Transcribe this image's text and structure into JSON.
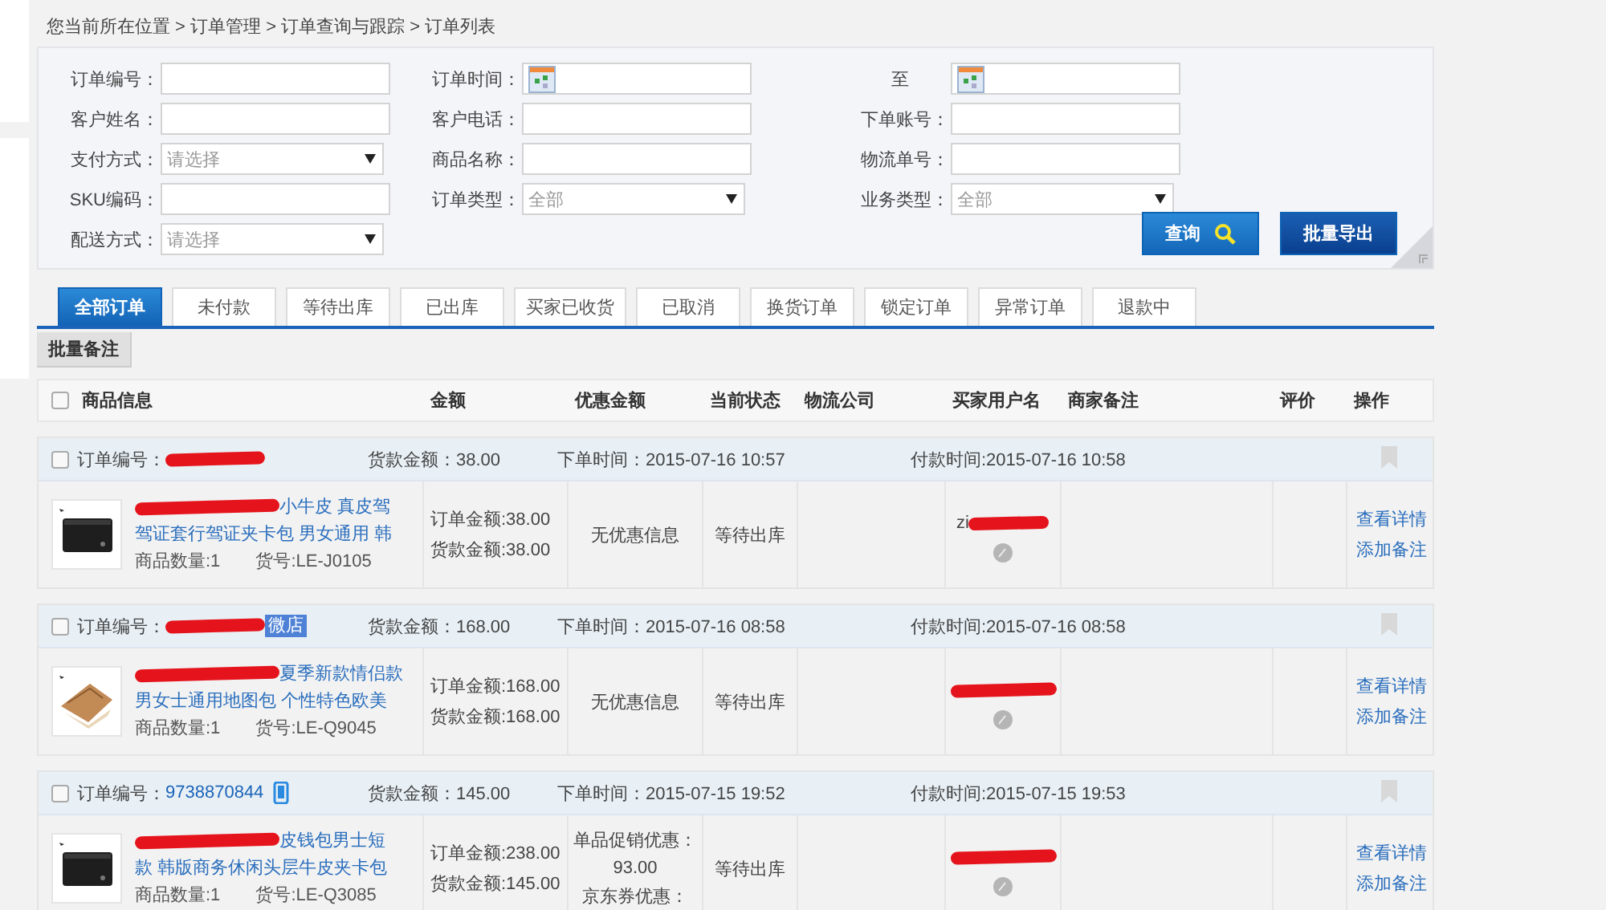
{
  "breadcrumb": "您当前所在位置 > 订单管理 > 订单查询与跟踪 > 订单列表",
  "filters": [
    {
      "label": "订单编号：",
      "kind": "text"
    },
    {
      "label": "订单时间：",
      "kind": "date"
    },
    {
      "label": "至",
      "kind": "date"
    },
    {
      "label": "客户姓名：",
      "kind": "text"
    },
    {
      "label": "客户电话：",
      "kind": "text"
    },
    {
      "label": "下单账号：",
      "kind": "text"
    },
    {
      "label": "支付方式：",
      "kind": "select",
      "value": "请选择"
    },
    {
      "label": "商品名称：",
      "kind": "text"
    },
    {
      "label": "物流单号：",
      "kind": "text"
    },
    {
      "label": "SKU编码：",
      "kind": "text"
    },
    {
      "label": "订单类型：",
      "kind": "select",
      "value": "全部"
    },
    {
      "label": "业务类型：",
      "kind": "select",
      "value": "全部"
    },
    {
      "label": "配送方式：",
      "kind": "select",
      "value": "请选择"
    }
  ],
  "buttons": [
    {
      "label": "查询",
      "kind": "search"
    },
    {
      "label": "批量导出",
      "kind": "export"
    }
  ],
  "tabs": [
    {
      "label": "全部订单",
      "selected": true
    },
    {
      "label": "未付款",
      "selected": false
    },
    {
      "label": "等待出库",
      "selected": false
    },
    {
      "label": "已出库",
      "selected": false
    },
    {
      "label": "买家已收货",
      "selected": false
    },
    {
      "label": "已取消",
      "selected": false
    },
    {
      "label": "换货订单",
      "selected": false
    },
    {
      "label": "锁定订单",
      "selected": false
    },
    {
      "label": "异常订单",
      "selected": false
    },
    {
      "label": "退款中",
      "selected": false
    }
  ],
  "batch_button": "批量备注",
  "table": {
    "checked": false,
    "columns": [
      "商品信息",
      "金额",
      "优惠金额",
      "当前状态",
      "物流公司",
      "买家用户名",
      "商家备注",
      "评价",
      "操作"
    ]
  },
  "orders": [
    {
      "checked": false,
      "id_label": "订单编号：",
      "id_redacted": true,
      "goods_amount": "货款金额：38.00",
      "order_time": "下单时间：2015-07-16 10:57",
      "pay_time": "付款时间:2015-07-16 10:58",
      "product": {
        "title_redacted": true,
        "title": [
          "小牛皮 真皮驾",
          "驾证套行驾证夹卡包 男女通用 韩"
        ],
        "quantity": "商品数量:1",
        "sku": "货号:LE-J0105"
      },
      "amounts": [
        "订单金额:38.00",
        "货款金额:38.00"
      ],
      "discount": [
        "无优惠信息"
      ],
      "status": "等待出库",
      "buyer": "zi",
      "buyer_redacted": true,
      "actions": [
        "查看详情",
        "添加备注"
      ]
    },
    {
      "checked": false,
      "id_label": "订单编号：",
      "id_redacted": true,
      "badge": "微店",
      "goods_amount": "货款金额：168.00",
      "order_time": "下单时间：2015-07-16 08:58",
      "pay_time": "付款时间:2015-07-16 08:58",
      "product": {
        "title_redacted": true,
        "title": [
          "夏季新款情侣款",
          "男女士通用地图包 个性特色欧美"
        ],
        "quantity": "商品数量:1",
        "sku": "货号:LE-Q9045"
      },
      "amounts": [
        "订单金额:168.00",
        "货款金额:168.00"
      ],
      "discount": [
        "无优惠信息"
      ],
      "status": "等待出库",
      "buyer_redacted": true,
      "actions": [
        "查看详情",
        "添加备注"
      ]
    },
    {
      "checked": false,
      "id_label": "订单编号：",
      "id": "9738870844",
      "id_redacted": false,
      "mobile": true,
      "goods_amount": "货款金额：145.00",
      "order_time": "下单时间：2015-07-15 19:52",
      "pay_time": "付款时间:2015-07-15 19:53",
      "product": {
        "title_redacted": true,
        "title": [
          "皮钱包男士短",
          "款 韩版商务休闲头层牛皮夹卡包"
        ],
        "quantity": "商品数量:1",
        "sku": "货号:LE-Q3085"
      },
      "amounts": [
        "订单金额:238.00",
        "货款金额:145.00"
      ],
      "discount": [
        "单品促销优惠：",
        "93.00",
        "京东券优惠："
      ],
      "status": "等待出库",
      "buyer_redacted": true,
      "actions": [
        "查看详情",
        "添加备注"
      ]
    }
  ]
}
